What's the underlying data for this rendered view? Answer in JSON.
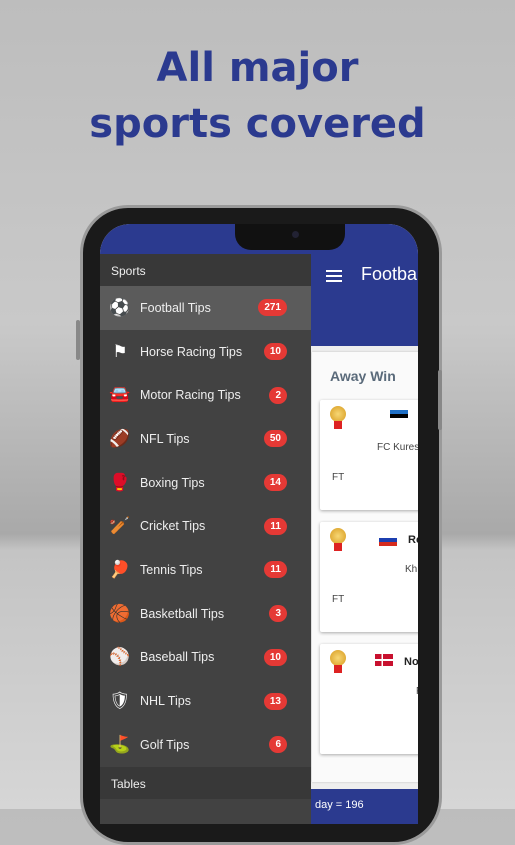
{
  "headline": [
    "All major",
    "sports covered"
  ],
  "app": {
    "title": "Football",
    "section": "Away Win",
    "footer": "day = 196"
  },
  "matches": [
    {
      "team": "FC Kures",
      "status": "FT",
      "flag": "estonia"
    },
    {
      "team": "Kh",
      "code": "Ro",
      "status": "FT",
      "flag": "russia"
    },
    {
      "code": "No",
      "team": "F",
      "status": "",
      "flag": "norway"
    }
  ],
  "drawer": {
    "sports_header": "Sports",
    "tables_header": "Tables",
    "items": [
      {
        "label": "Football Tips",
        "count": "271",
        "icon": "soccer-ball-icon",
        "glyph": "⚽"
      },
      {
        "label": "Horse Racing Tips",
        "count": "10",
        "icon": "flag-icon",
        "glyph": "⚑"
      },
      {
        "label": "Motor Racing Tips",
        "count": "2",
        "icon": "car-icon",
        "glyph": "🚘"
      },
      {
        "label": "NFL Tips",
        "count": "50",
        "icon": "american-football-icon",
        "glyph": "🏈"
      },
      {
        "label": "Boxing Tips",
        "count": "14",
        "icon": "boxing-glove-icon",
        "glyph": "🥊"
      },
      {
        "label": "Cricket Tips",
        "count": "11",
        "icon": "cricket-bat-icon",
        "glyph": "🏏"
      },
      {
        "label": "Tennis Tips",
        "count": "11",
        "icon": "table-tennis-icon",
        "glyph": "🏓"
      },
      {
        "label": "Basketball Tips",
        "count": "3",
        "icon": "basketball-icon",
        "glyph": "🏀"
      },
      {
        "label": "Baseball Tips",
        "count": "10",
        "icon": "baseball-icon",
        "glyph": "⚾"
      },
      {
        "label": "NHL Tips",
        "count": "13",
        "icon": "nhl-shield-icon",
        "glyph": "🛡"
      },
      {
        "label": "Golf Tips",
        "count": "6",
        "icon": "golf-clubs-icon",
        "glyph": "⛳"
      }
    ]
  },
  "colors": {
    "brand": "#2b3a8f",
    "badge": "#e53935",
    "drawer": "#424242"
  }
}
